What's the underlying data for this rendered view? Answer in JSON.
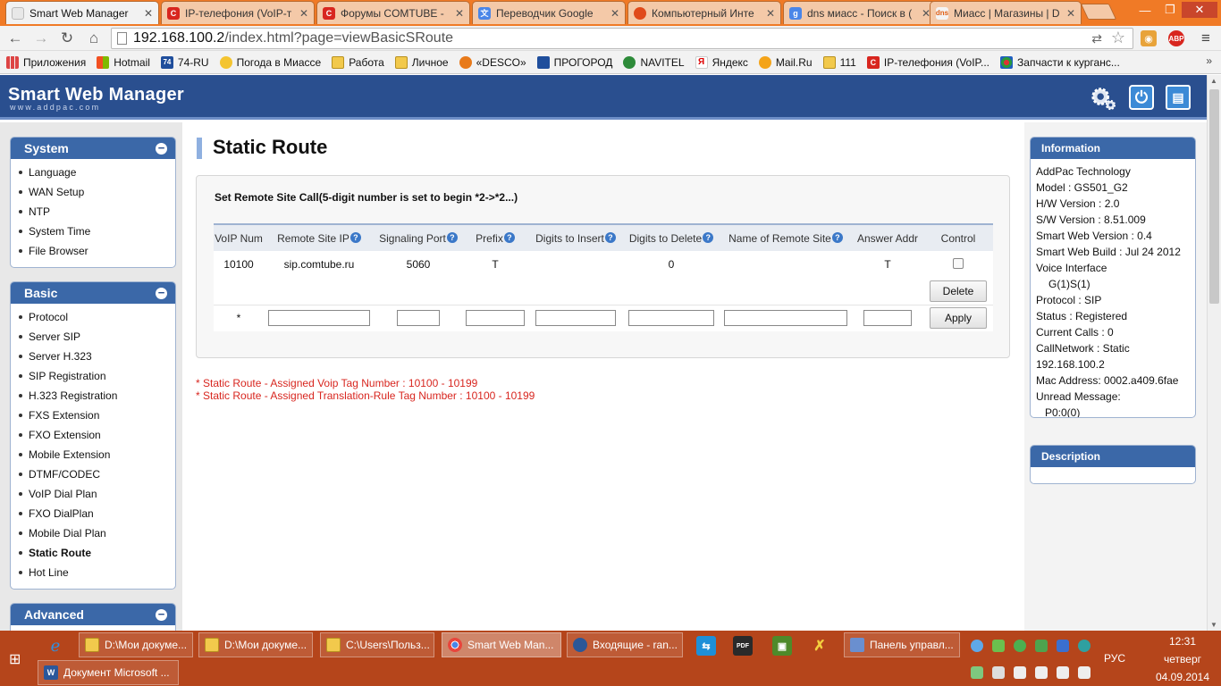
{
  "browser": {
    "tabs": [
      {
        "title": "Smart Web Manager",
        "active": true
      },
      {
        "title": "IP-телефония (VoIP-т",
        "active": false
      },
      {
        "title": "Форумы COMTUBE -",
        "active": false
      },
      {
        "title": "Переводчик Google",
        "active": false
      },
      {
        "title": "Компьютерный Инте",
        "active": false
      },
      {
        "title": "dns миасс - Поиск в (",
        "active": false
      },
      {
        "title": "Миасс | Магазины | D",
        "active": false
      }
    ],
    "url_host": "192.168.100.2",
    "url_path": "/index.html?page=viewBasicSRoute",
    "abp_label": "ABP",
    "bookmarks": [
      {
        "label": "Приложения",
        "icon": "apps-icon"
      },
      {
        "label": "Hotmail",
        "icon": "windows-logo-icon"
      },
      {
        "label": "74-RU",
        "icon": "74-logo-icon"
      },
      {
        "label": "Погода в Миассе",
        "icon": "weather-icon"
      },
      {
        "label": "Работа",
        "icon": "folder-icon"
      },
      {
        "label": "Личное",
        "icon": "folder-icon"
      },
      {
        "label": "«DESCO»",
        "icon": "desco-icon"
      },
      {
        "label": "ПРОГОРОД",
        "icon": "progorod-icon"
      },
      {
        "label": "NAVITEL",
        "icon": "navitel-icon"
      },
      {
        "label": "Яндекс",
        "icon": "yandex-icon"
      },
      {
        "label": "Mail.Ru",
        "icon": "mailru-icon"
      },
      {
        "label": "111",
        "icon": "folder-icon"
      },
      {
        "label": "IP-телефония (VoIP...",
        "icon": "comtube-icon"
      },
      {
        "label": "Запчасти к курганс...",
        "icon": "parts-icon"
      }
    ]
  },
  "app": {
    "brand": "Smart Web Manager",
    "brand_sub": "www.addpac.com"
  },
  "sidebar": {
    "system": {
      "title": "System",
      "items": [
        "Language",
        "WAN Setup",
        "NTP",
        "System Time",
        "File Browser"
      ]
    },
    "basic": {
      "title": "Basic",
      "items": [
        "Protocol",
        "Server SIP",
        "Server H.323",
        "SIP Registration",
        "H.323 Registration",
        "FXS Extension",
        "FXO Extension",
        "Mobile Extension",
        "DTMF/CODEC",
        "VoIP Dial Plan",
        "FXO DialPlan",
        "Mobile Dial Plan",
        "Static Route",
        "Hot Line"
      ],
      "current": "Static Route"
    },
    "advanced": {
      "title": "Advanced"
    }
  },
  "main": {
    "title": "Static Route",
    "caption": "Set Remote Site Call(5-digit number is set to begin *2->*2...)",
    "columns": [
      "VoIP Num",
      "Remote Site IP",
      "Signaling Port",
      "Prefix",
      "Digits to Insert",
      "Digits to Delete",
      "Name of Remote Site",
      "Answer Addr",
      "Control"
    ],
    "row": {
      "voip_num": "10100",
      "remote_ip": "sip.comtube.ru",
      "port": "5060",
      "prefix": "T",
      "insert": "",
      "delete": "0",
      "name": "",
      "answer": "T",
      "checked": false
    },
    "delete_label": "Delete",
    "new_row_marker": "*",
    "apply_label": "Apply",
    "notes": [
      "* Static Route - Assigned Voip Tag Number : 10100 - 10199",
      "* Static Route - Assigned Translation-Rule Tag Number : 10100 - 10199"
    ]
  },
  "info": {
    "title": "Information",
    "lines": [
      "AddPac Technology",
      "Model : GS501_G2",
      "H/W Version : 2.0",
      "S/W Version : 8.51.009",
      "Smart Web Version : 0.4",
      "Smart Web Build : Jul 24 2012",
      "Voice Interface",
      "G(1)S(1)",
      "Protocol : SIP",
      "Status : Registered",
      "Current Calls : 0",
      "CallNetwork : Static",
      "192.168.100.2",
      "Mac Address: 0002.a409.6fae",
      "Unread Message:",
      "P0:0(0)"
    ],
    "description_title": "Description"
  },
  "taskbar": {
    "buttons_row1": [
      "D:\\Мои докуме...",
      "D:\\Мои докуме...",
      "C:\\Users\\Польз...",
      "Smart Web Man...",
      "Входящие - ran...",
      "Панель управл..."
    ],
    "active": "Smart Web Man...",
    "buttons_row2": [
      "Документ Microsoft ..."
    ],
    "lang": "РУС",
    "time": "12:31",
    "day": "четверг",
    "date": "04.09.2014"
  }
}
